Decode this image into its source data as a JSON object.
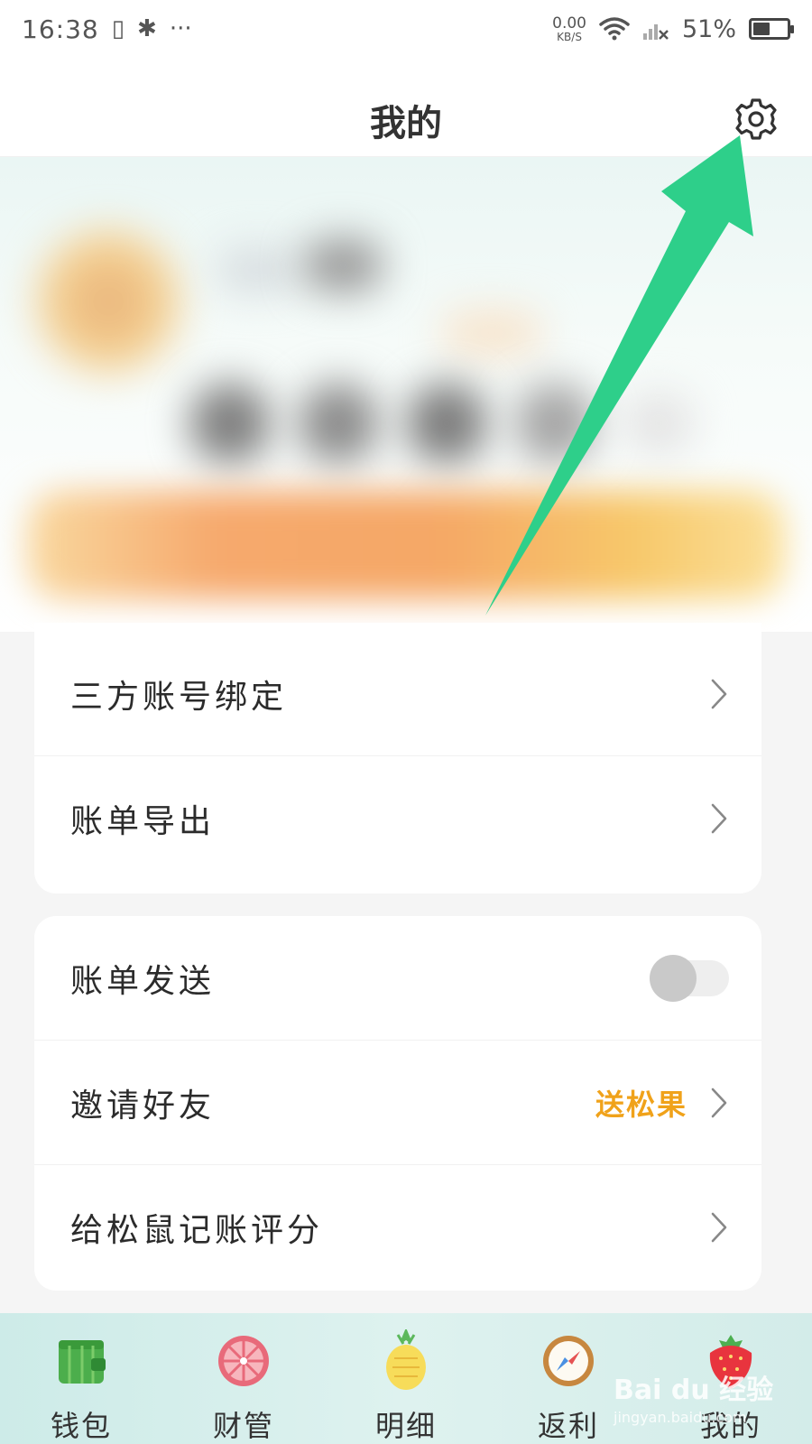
{
  "status_bar": {
    "time": "16:38",
    "vibrate_glyph": "▯",
    "bluetooth_glyph": "✱",
    "more_glyph": "···",
    "net_speed": "0.00",
    "net_unit": "KB/S",
    "battery": "51%",
    "battery_level": 0.51
  },
  "header": {
    "title": "我的"
  },
  "menu_group1": {
    "items": [
      {
        "label": "三方账号绑定"
      },
      {
        "label": "账单导出"
      }
    ]
  },
  "menu_group2": {
    "bill_send": {
      "label": "账单发送",
      "toggle_on": false
    },
    "invite": {
      "label": "邀请好友",
      "tag": "送松果"
    },
    "rate": {
      "label": "给松鼠记账评分"
    }
  },
  "bottom_nav": {
    "items": [
      {
        "label": "钱包",
        "icon": "wallet-icon"
      },
      {
        "label": "财管",
        "icon": "grapefruit-icon"
      },
      {
        "label": "明细",
        "icon": "pineapple-icon"
      },
      {
        "label": "返利",
        "icon": "compass-icon"
      },
      {
        "label": "我的",
        "icon": "strawberry-icon"
      }
    ]
  },
  "watermark": {
    "main": "Bai du 经验",
    "sub": "jingyan.baidu.com"
  },
  "colors": {
    "accent_arrow": "#2ecf8a",
    "tag_orange": "#f0a21a",
    "nav_bg": "#d6eeeb"
  }
}
